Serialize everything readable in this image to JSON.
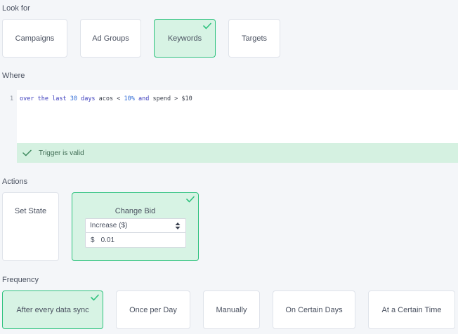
{
  "look_for": {
    "label": "Look for",
    "options": [
      {
        "label": "Campaigns",
        "selected": false
      },
      {
        "label": "Ad Groups",
        "selected": false
      },
      {
        "label": "Keywords",
        "selected": true
      },
      {
        "label": "Targets",
        "selected": false
      }
    ]
  },
  "where": {
    "label": "Where",
    "line_number": "1",
    "code_tokens": [
      {
        "t": "over",
        "k": "kw"
      },
      {
        "t": " ",
        "k": "op"
      },
      {
        "t": "the",
        "k": "kw"
      },
      {
        "t": " ",
        "k": "op"
      },
      {
        "t": "last",
        "k": "kw"
      },
      {
        "t": " ",
        "k": "op"
      },
      {
        "t": "30",
        "k": "num"
      },
      {
        "t": " ",
        "k": "op"
      },
      {
        "t": "days",
        "k": "kw"
      },
      {
        "t": " acos < ",
        "k": "id"
      },
      {
        "t": "10%",
        "k": "num"
      },
      {
        "t": " ",
        "k": "op"
      },
      {
        "t": "and",
        "k": "kw"
      },
      {
        "t": " spend > ",
        "k": "id"
      },
      {
        "t": "$10",
        "k": "id"
      }
    ],
    "validation_text": "Trigger is valid"
  },
  "actions": {
    "label": "Actions",
    "set_state_label": "Set State",
    "change_bid": {
      "label": "Change Bid",
      "selected": true,
      "mode_value": "Increase ($)",
      "currency_symbol": "$",
      "amount_value": "0.01"
    }
  },
  "frequency": {
    "label": "Frequency",
    "options": [
      {
        "label": "After every data sync",
        "selected": true
      },
      {
        "label": "Once per Day",
        "selected": false
      },
      {
        "label": "Manually",
        "selected": false
      },
      {
        "label": "On Certain Days",
        "selected": false
      },
      {
        "label": "At a Certain Time",
        "selected": false
      }
    ]
  },
  "colors": {
    "accent": "#2ec27e",
    "selected_bg": "#d7f3e4",
    "valid_bg": "#d5f1e1",
    "keyword": "#3c3dbd",
    "number": "#2f6bd6"
  },
  "icons": {
    "selected_check": "check-icon",
    "valid_check": "check-icon",
    "select_arrows": "sort-arrows-icon"
  }
}
